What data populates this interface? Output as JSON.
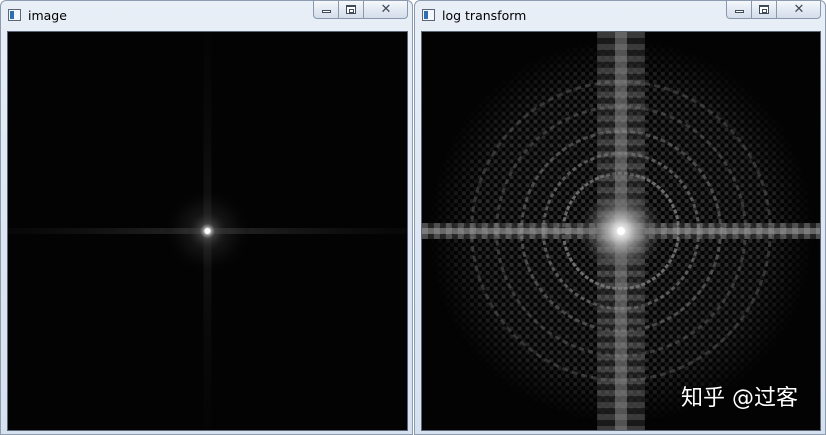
{
  "windows": [
    {
      "title": "image",
      "controls": {
        "minimize": "minimize-icon",
        "maximize": "maximize-icon",
        "close": "close-icon"
      },
      "content": "fft-magnitude-spectrum"
    },
    {
      "title": "log transform",
      "controls": {
        "minimize": "minimize-icon",
        "maximize": "maximize-icon",
        "close": "close-icon"
      },
      "content": "log-transformed-spectrum"
    }
  ],
  "watermark": "知乎 @过客",
  "colors": {
    "titlebar": "#dfe8f3",
    "canvas": "#020202",
    "border": "#8d9bb0"
  }
}
